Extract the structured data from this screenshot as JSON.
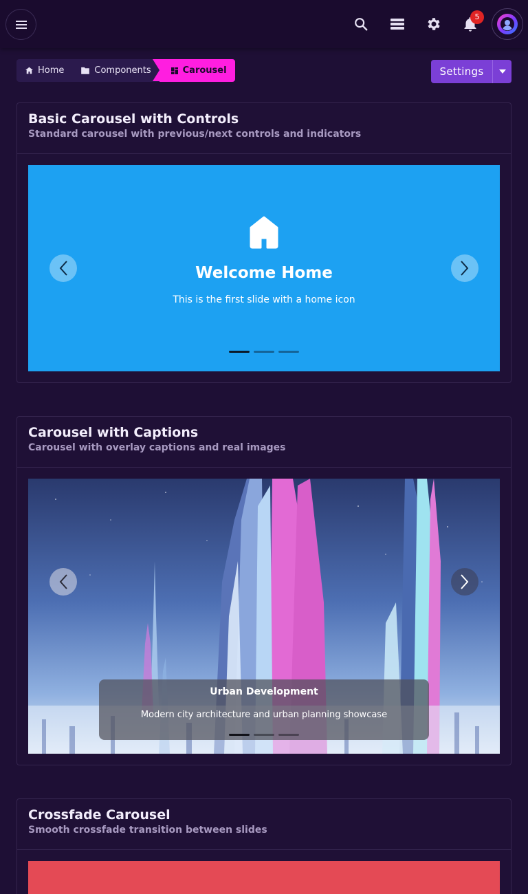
{
  "topbar": {
    "menu_icon": "hamburger-icon",
    "icons": [
      "search-icon",
      "layers-icon",
      "gear-icon",
      "bell-icon"
    ],
    "notification_count": "5",
    "avatar_icon": "user-avatar-icon"
  },
  "breadcrumb": {
    "items": [
      {
        "label": "Home",
        "icon": "home-icon"
      },
      {
        "label": "Components",
        "icon": "folder-icon"
      },
      {
        "label": "Carousel",
        "icon": "dashboard-icon"
      }
    ],
    "active_color": "#ff1ee0"
  },
  "settings": {
    "label": "Settings",
    "color": "#7b3fd6"
  },
  "cards": [
    {
      "title": "Basic Carousel with Controls",
      "subtitle": "Standard carousel with previous/next controls and indicators",
      "slide": {
        "icon": "home-icon",
        "title": "Welcome Home",
        "text": "This is the first slide with a home icon",
        "background": "#1da1f2"
      },
      "indicators": 3,
      "active_indicator": 0
    },
    {
      "title": "Carousel with Captions",
      "subtitle": "Carousel with overlay captions and real images",
      "slide": {
        "image": "futuristic-city-image",
        "caption_title": "Urban Development",
        "caption_text": "Modern city architecture and urban planning showcase"
      },
      "indicators": 3,
      "active_indicator": 0
    },
    {
      "title": "Crossfade Carousel",
      "subtitle": "Smooth crossfade transition between slides",
      "slide": {
        "background": "#e44a55"
      }
    }
  ]
}
